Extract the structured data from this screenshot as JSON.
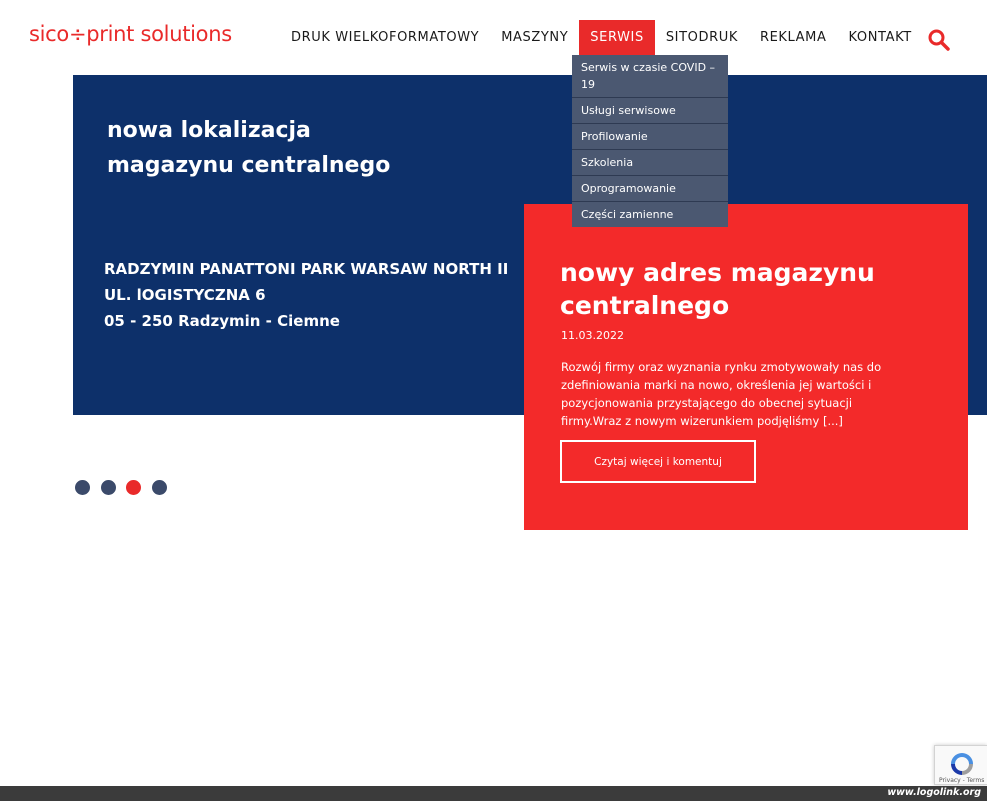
{
  "header": {
    "logo_text": "sico÷print solutions",
    "nav": [
      {
        "label": "DRUK WIELKOFORMATOWY"
      },
      {
        "label": "MASZYNY"
      },
      {
        "label": "SERWIS"
      },
      {
        "label": "SITODRUK"
      },
      {
        "label": "REKLAMA"
      },
      {
        "label": "KONTAKT"
      }
    ],
    "active_nav": "SERWIS",
    "search_icon": "search-icon"
  },
  "dropdown": {
    "items": [
      {
        "label": "Serwis w czasie COVID – 19"
      },
      {
        "label": "Usługi serwisowe"
      },
      {
        "label": "Profilowanie"
      },
      {
        "label": "Szkolenia"
      },
      {
        "label": "Oprogramowanie"
      },
      {
        "label": "Części zamienne"
      }
    ]
  },
  "slide": {
    "heading_line1": "nowa lokalizacja",
    "heading_line2": "magazynu centralnego",
    "address_line1": "RADZYMIN PANATTONI PARK WARSAW NORTH II",
    "address_line2": "UL. lOGISTYCZNA 6",
    "address_line3": "05 - 250 Radzymin - Ciemne"
  },
  "card": {
    "title": "nowy adres magazynu centralnego",
    "date": "11.03.2022",
    "text": "Rozwój firmy oraz wyznania rynku zmotywowały nas do zdefiniowania marki na nowo, określenia jej wartości i pozycjonowania przystającego do obecnej sytuacji firmy.Wraz z nowym wizerunkiem podjęliśmy [...]",
    "button_label": "Czytaj więcej i komentuj"
  },
  "slider": {
    "dot_count": 4,
    "active_dot": 3
  },
  "recaptcha": {
    "terms_text": "Privacy - Terms"
  },
  "footer": {
    "watermark": "www.logolink.org"
  },
  "colors": {
    "brand_red": "#e92a2a",
    "card_red": "#f32a2a",
    "navy": "#0d306a",
    "dropdown_bg": "#4b5871",
    "dot_inactive": "#3b4a6a"
  }
}
